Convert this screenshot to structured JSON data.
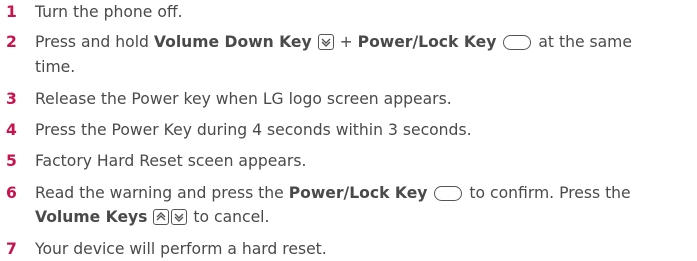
{
  "steps": [
    {
      "num": "1",
      "text": "Turn the phone off."
    },
    {
      "num": "2",
      "p1": "Press and hold ",
      "b1": "Volume Down Key",
      "p2": " + ",
      "b2": "Power/Lock Key",
      "p3": " at the same",
      "p4": "time."
    },
    {
      "num": "3",
      "text": "Release the Power key when LG logo screen appears."
    },
    {
      "num": "4",
      "text": "Press the Power Key during 4 seconds within 3 seconds."
    },
    {
      "num": "5",
      "text": "Factory Hard Reset sceen appears."
    },
    {
      "num": "6",
      "p1": "Read the warning and press the ",
      "b1": "Power/Lock Key",
      "p2": " to confirm. Press the",
      "b2": "Volume Keys",
      "p3": " to cancel."
    },
    {
      "num": "7",
      "text": "Your device will perform a hard reset."
    }
  ],
  "colors": {
    "number": "#c8144e",
    "text": "#4a4a4a"
  },
  "icons": {
    "volume_down": "volume-down-key-icon",
    "volume_up": "volume-up-key-icon",
    "power": "power-lock-key-icon"
  }
}
